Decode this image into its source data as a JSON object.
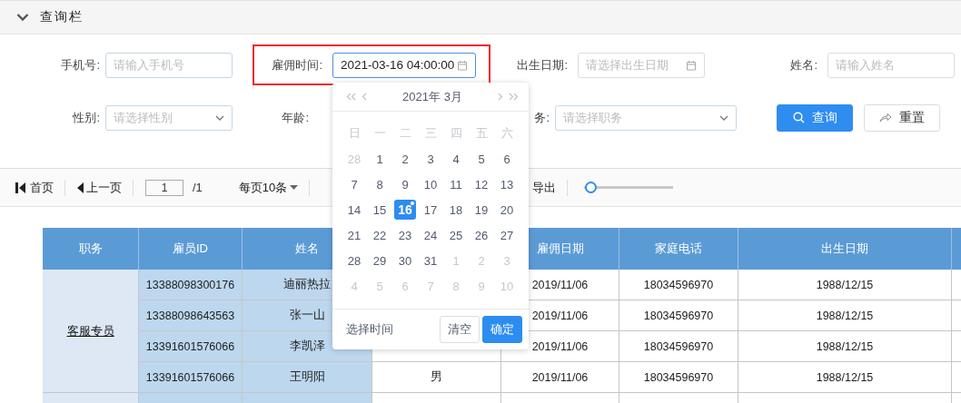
{
  "panel": {
    "title": "查询栏",
    "expanded": true
  },
  "form": {
    "row_1": [
      {
        "kind": "input",
        "label": "手机号:",
        "placeholder": "请输入手机号"
      },
      {
        "kind": "date",
        "label": "雇佣时间:",
        "value": "2021-03-16 04:00:00",
        "highlighted": true,
        "focused": true
      },
      {
        "kind": "date",
        "label": "出生日期:",
        "placeholder": "请选择出生日期"
      },
      {
        "kind": "input",
        "label": "姓名:",
        "placeholder": "请输入姓名"
      }
    ],
    "row_2": [
      {
        "kind": "select",
        "label": "性别:",
        "placeholder": "请选择性别"
      },
      {
        "kind": "label",
        "label": "年龄:"
      },
      {
        "kind": "select",
        "label": "务:",
        "placeholder": "请选择职务"
      }
    ],
    "buttons": [
      {
        "kind": "primary",
        "label": "查询"
      },
      {
        "kind": "default",
        "label": "重置"
      }
    ]
  },
  "toolbar": {
    "first": "首页",
    "prev": "上一页",
    "page": "1",
    "total": "/1",
    "page_size": "每页10条",
    "export": "导出",
    "zoom": {
      "level": 0.07
    }
  },
  "table": {
    "columns": [
      "职务",
      "雇员ID",
      "姓名",
      "雇佣日期",
      "家庭电话",
      "出生日期"
    ],
    "group": "客服专员",
    "rows": [
      {
        "id": "13388098300176",
        "name": "迪丽热拉",
        "hire_date": "2019/11/06",
        "phone": "18034596970",
        "birth": "1988/12/15"
      },
      {
        "id": "13388098643563",
        "name": "张一山",
        "hire_date": "2019/11/06",
        "phone": "18034596970",
        "birth": "1988/12/15"
      },
      {
        "id": "13391601576066",
        "name": "李凯泽",
        "hire_date": "2019/11/06",
        "phone": "18034596970",
        "birth": "1988/12/15"
      },
      {
        "id": "13391601576066",
        "name": "王明阳",
        "gender": "男",
        "hire_date": "2019/11/06",
        "phone": "18034596970",
        "birth": "1988/12/15"
      }
    ]
  },
  "calendar": {
    "title": "2021年 3月",
    "weekdays": [
      "日",
      "一",
      "二",
      "三",
      "四",
      "五",
      "六"
    ],
    "weeks": [
      [
        {
          "label": "28",
          "muted": true,
          "selected": false,
          "today": false
        },
        {
          "label": "1",
          "muted": false,
          "selected": false,
          "today": false
        },
        {
          "label": "2",
          "muted": false,
          "selected": false,
          "today": false
        },
        {
          "label": "3",
          "muted": false,
          "selected": false,
          "today": false
        },
        {
          "label": "4",
          "muted": false,
          "selected": false,
          "today": false
        },
        {
          "label": "5",
          "muted": false,
          "selected": false,
          "today": false
        },
        {
          "label": "6",
          "muted": false,
          "selected": false,
          "today": false
        }
      ],
      [
        {
          "label": "7",
          "muted": false,
          "selected": false,
          "today": false
        },
        {
          "label": "8",
          "muted": false,
          "selected": false,
          "today": false
        },
        {
          "label": "9",
          "muted": false,
          "selected": false,
          "today": false
        },
        {
          "label": "10",
          "muted": false,
          "selected": false,
          "today": false
        },
        {
          "label": "11",
          "muted": false,
          "selected": false,
          "today": false
        },
        {
          "label": "12",
          "muted": false,
          "selected": false,
          "today": false
        },
        {
          "label": "13",
          "muted": false,
          "selected": false,
          "today": false
        }
      ],
      [
        {
          "label": "14",
          "muted": false,
          "selected": false,
          "today": false
        },
        {
          "label": "15",
          "muted": false,
          "selected": false,
          "today": false
        },
        {
          "label": "16",
          "muted": false,
          "selected": true,
          "today": true
        },
        {
          "label": "17",
          "muted": false,
          "selected": false,
          "today": false
        },
        {
          "label": "18",
          "muted": false,
          "selected": false,
          "today": false
        },
        {
          "label": "19",
          "muted": false,
          "selected": false,
          "today": false
        },
        {
          "label": "20",
          "muted": false,
          "selected": false,
          "today": false
        }
      ],
      [
        {
          "label": "21",
          "muted": false,
          "selected": false,
          "today": false
        },
        {
          "label": "22",
          "muted": false,
          "selected": false,
          "today": false
        },
        {
          "label": "23",
          "muted": false,
          "selected": false,
          "today": false
        },
        {
          "label": "24",
          "muted": false,
          "selected": false,
          "today": false
        },
        {
          "label": "25",
          "muted": false,
          "selected": false,
          "today": false
        },
        {
          "label": "26",
          "muted": false,
          "selected": false,
          "today": false
        },
        {
          "label": "27",
          "muted": false,
          "selected": false,
          "today": false
        }
      ],
      [
        {
          "label": "28",
          "muted": false,
          "selected": false,
          "today": false
        },
        {
          "label": "29",
          "muted": false,
          "selected": false,
          "today": false
        },
        {
          "label": "30",
          "muted": false,
          "selected": false,
          "today": false
        },
        {
          "label": "31",
          "muted": false,
          "selected": false,
          "today": false
        },
        {
          "label": "1",
          "muted": true,
          "selected": false,
          "today": false
        },
        {
          "label": "2",
          "muted": true,
          "selected": false,
          "today": false
        },
        {
          "label": "3",
          "muted": true,
          "selected": false,
          "today": false
        }
      ],
      [
        {
          "label": "4",
          "muted": true,
          "selected": false,
          "today": false
        },
        {
          "label": "5",
          "muted": true,
          "selected": false,
          "today": false
        },
        {
          "label": "6",
          "muted": true,
          "selected": false,
          "today": false
        },
        {
          "label": "7",
          "muted": true,
          "selected": false,
          "today": false
        },
        {
          "label": "8",
          "muted": true,
          "selected": false,
          "today": false
        },
        {
          "label": "9",
          "muted": true,
          "selected": false,
          "today": false
        },
        {
          "label": "10",
          "muted": true,
          "selected": false,
          "today": false
        }
      ]
    ],
    "footer_link": "选择时间",
    "clear": "清空",
    "confirm": "确定"
  }
}
